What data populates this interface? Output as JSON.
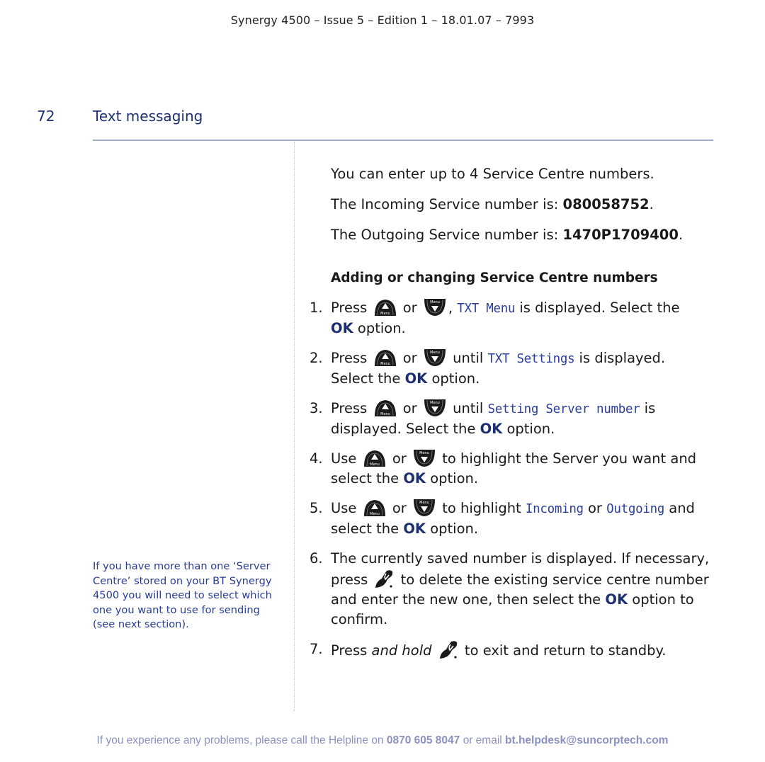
{
  "header": {
    "text": "Synergy 4500 – Issue 5 –  Edition 1 – 18.01.07 – 7993"
  },
  "page": {
    "number": "72",
    "section_title": "Text messaging"
  },
  "sidenote": {
    "text": "If you have more than one ‘Server Centre’ stored on your BT Synergy 4500 you will need to select which one you want to use for sending (see next section)."
  },
  "intro": {
    "line1": "You can enter up to 4 Service Centre numbers.",
    "incoming_prefix": "The Incoming Service number is: ",
    "incoming_number": "080058752",
    "outgoing_prefix": "The Outgoing Service number is: ",
    "outgoing_number": "1470P1709400",
    "period": "."
  },
  "subheading": "Adding or changing Service Centre numbers",
  "icons": {
    "up_key": "menu-up-key-icon",
    "down_key": "menu-down-key-icon",
    "key_label": "Menu",
    "hangup": "end-call-key-icon"
  },
  "steps": [
    {
      "num": "1.",
      "verb": "Press",
      "or": "or",
      "comma": ",",
      "lcd": "TXT Menu",
      "after": " is displayed. Select the",
      "ok": "OK",
      "tail": " option."
    },
    {
      "num": "2.",
      "verb": "Press",
      "or": "or",
      "until": " until ",
      "lcd": "TXT Settings",
      "after": " is displayed.",
      "pre_ok": "Select the ",
      "ok": "OK",
      "tail": " option."
    },
    {
      "num": "3.",
      "verb": "Press",
      "or": "or",
      "until": " until ",
      "lcd": "Setting Server number",
      "after": " is",
      "pre_ok": "displayed. Select the ",
      "ok": "OK",
      "tail": " option."
    },
    {
      "num": "4.",
      "verb": "Use",
      "or": "or",
      "after": " to highlight the Server you want and",
      "pre_ok": "select the ",
      "ok": "OK",
      "tail": " option."
    },
    {
      "num": "5.",
      "verb": "Use",
      "or": "or",
      "after": " to highlight ",
      "lcd1": "Incoming",
      "mid": " or ",
      "lcd2": "Outgoing",
      "after2": " and",
      "pre_ok": "select the ",
      "ok": "OK",
      "tail": " option."
    },
    {
      "num": "6.",
      "line1": "The currently saved number is displayed. If necessary,",
      "press": "press ",
      "after": " to delete the existing service centre number",
      "pre_ok": "and enter the new one, then select the ",
      "ok": "OK",
      "tail": " option to",
      "line4": "confirm."
    },
    {
      "num": "7.",
      "verb": "Press ",
      "ital": "and hold",
      "after": " to exit and return to standby."
    }
  ],
  "footer": {
    "prefix": "If you experience any problems, please call the Helpline on ",
    "phone": "0870 605 8047",
    "mid": " or email ",
    "email": "bt.helpdesk@suncorptech.com"
  },
  "colors": {
    "accent": "#1d2f6e",
    "lcd_text": "#2c3f9a",
    "footer": "#8b92bf",
    "rule": "#a3aecb"
  }
}
